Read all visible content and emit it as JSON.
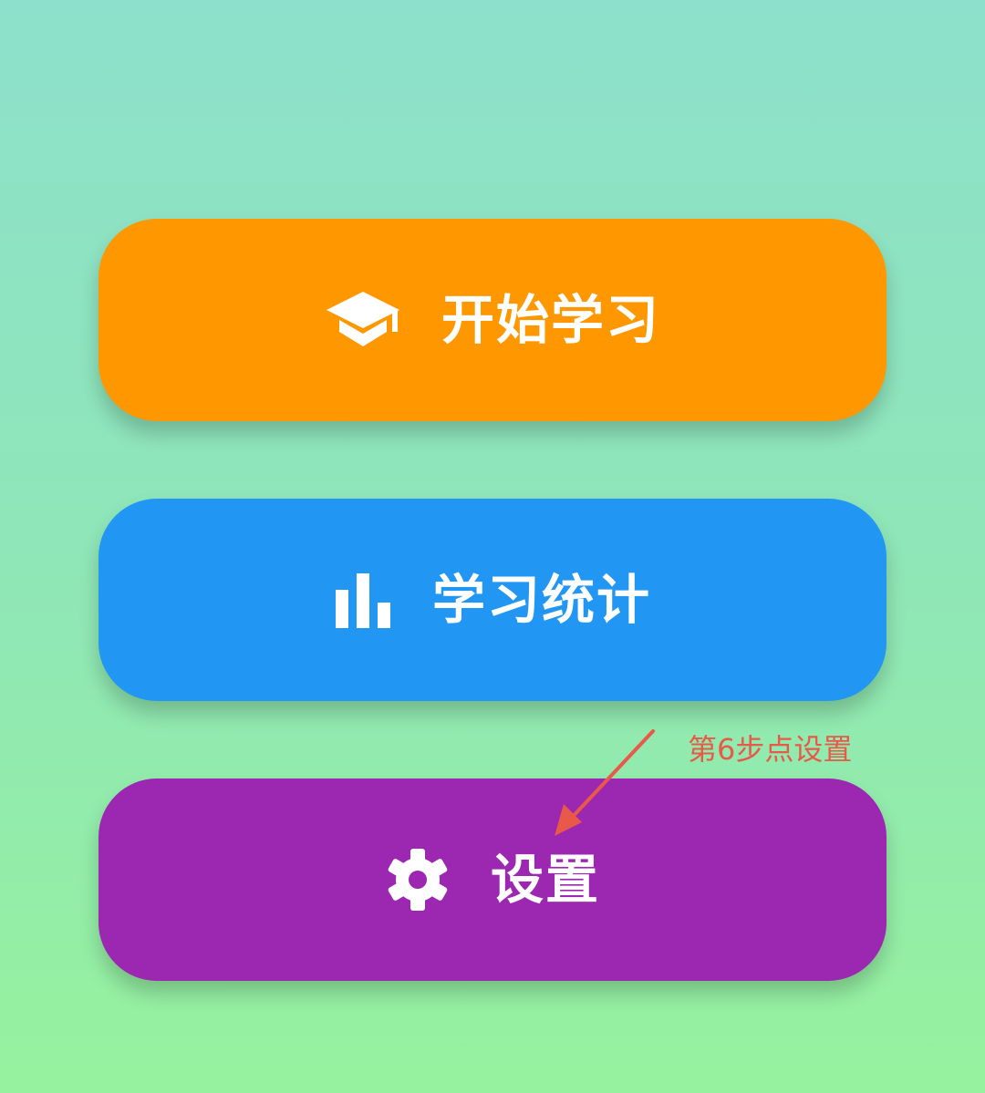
{
  "menu": {
    "start_study": {
      "label": "开始学习",
      "icon": "graduation-cap-icon",
      "color": "#ff9800"
    },
    "study_stats": {
      "label": "学习统计",
      "icon": "bar-chart-icon",
      "color": "#2196f3"
    },
    "settings": {
      "label": "设置",
      "icon": "gear-icon",
      "color": "#9c27b0"
    }
  },
  "annotation": {
    "text": "第6步点设置",
    "color": "#e8594a"
  }
}
